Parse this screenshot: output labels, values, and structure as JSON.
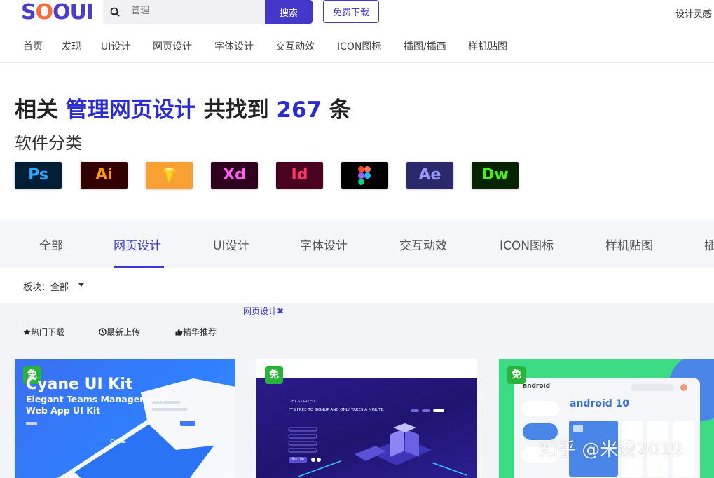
{
  "header": {
    "logo": "SOOUI",
    "search_placeholder": "管理",
    "search_button": "搜索",
    "free_download": "免费下载",
    "right_link": "设计灵感"
  },
  "main_nav": [
    "首页",
    "发现",
    "UI设计",
    "网页设计",
    "字体设计",
    "交互动效",
    "ICON图标",
    "插图/插画",
    "样机贴图"
  ],
  "heading": {
    "prefix": "相关",
    "keyword": "管理网页设计",
    "middle": "共找到",
    "count": "267",
    "suffix": "条"
  },
  "software_title": "软件分类",
  "software": [
    {
      "label": "Ps",
      "bg": "#001e36",
      "fg": "#31a8ff"
    },
    {
      "label": "Ai",
      "bg": "#330000",
      "fg": "#ff9a00"
    },
    {
      "label": "",
      "bg": "#f7a135",
      "fg": "#ffffff"
    },
    {
      "label": "Xd",
      "bg": "#2e001e",
      "fg": "#ff61f6"
    },
    {
      "label": "Id",
      "bg": "#49021f",
      "fg": "#ff3366"
    },
    {
      "label": "",
      "bg": "#000000",
      "fg": "#ffffff"
    },
    {
      "label": "Ae",
      "bg": "#2a2a6b",
      "fg": "#9999ff"
    },
    {
      "label": "Dw",
      "bg": "#072401",
      "fg": "#4cf20e"
    }
  ],
  "category_tabs": [
    "全部",
    "网页设计",
    "UI设计",
    "字体设计",
    "交互动效",
    "ICON图标",
    "样机贴图",
    "插"
  ],
  "active_tab": "网页设计",
  "filter": {
    "label": "板块：全部"
  },
  "active_tag": "网页设计✖",
  "sort_options": [
    "热门下载",
    "最新上传",
    "精华推荐"
  ],
  "cards": [
    {
      "badge": "免",
      "title": "Cyane UI Kit",
      "subtitle1": "Elegant Teams Management",
      "subtitle2": "Web App UI Kit",
      "brand": "CYANE"
    },
    {
      "badge": "免",
      "heading": "GET STARTED",
      "text": "IT'S FREE TO SIGNUP AND ONLY TAKES A MINUTE.",
      "button": "Sign Up"
    },
    {
      "badge": "免",
      "brand": "android",
      "title": "android 10"
    }
  ],
  "watermark": "知乎 @米设2019"
}
